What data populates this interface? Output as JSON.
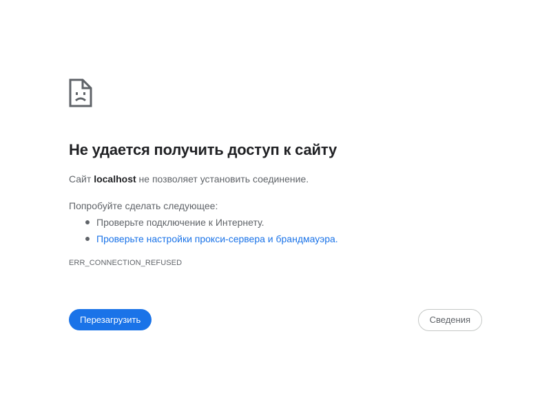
{
  "icon": "sad-page-icon",
  "title": "Не удается получить доступ к сайту",
  "description": {
    "prefix": "Сайт ",
    "host": "localhost",
    "suffix": " не позволяет установить соединение."
  },
  "suggestions": {
    "heading": "Попробуйте сделать следующее:",
    "items": [
      {
        "label": "Проверьте подключение к Интернету.",
        "is_link": false
      },
      {
        "label": "Проверьте настройки прокси-сервера и брандмауэра.",
        "is_link": true
      }
    ]
  },
  "error_code": "ERR_CONNECTION_REFUSED",
  "buttons": {
    "reload_label": "Перезагрузить",
    "details_label": "Сведения"
  },
  "colors": {
    "accent": "#1a73e8",
    "title": "#202124",
    "text": "#5f6368"
  }
}
